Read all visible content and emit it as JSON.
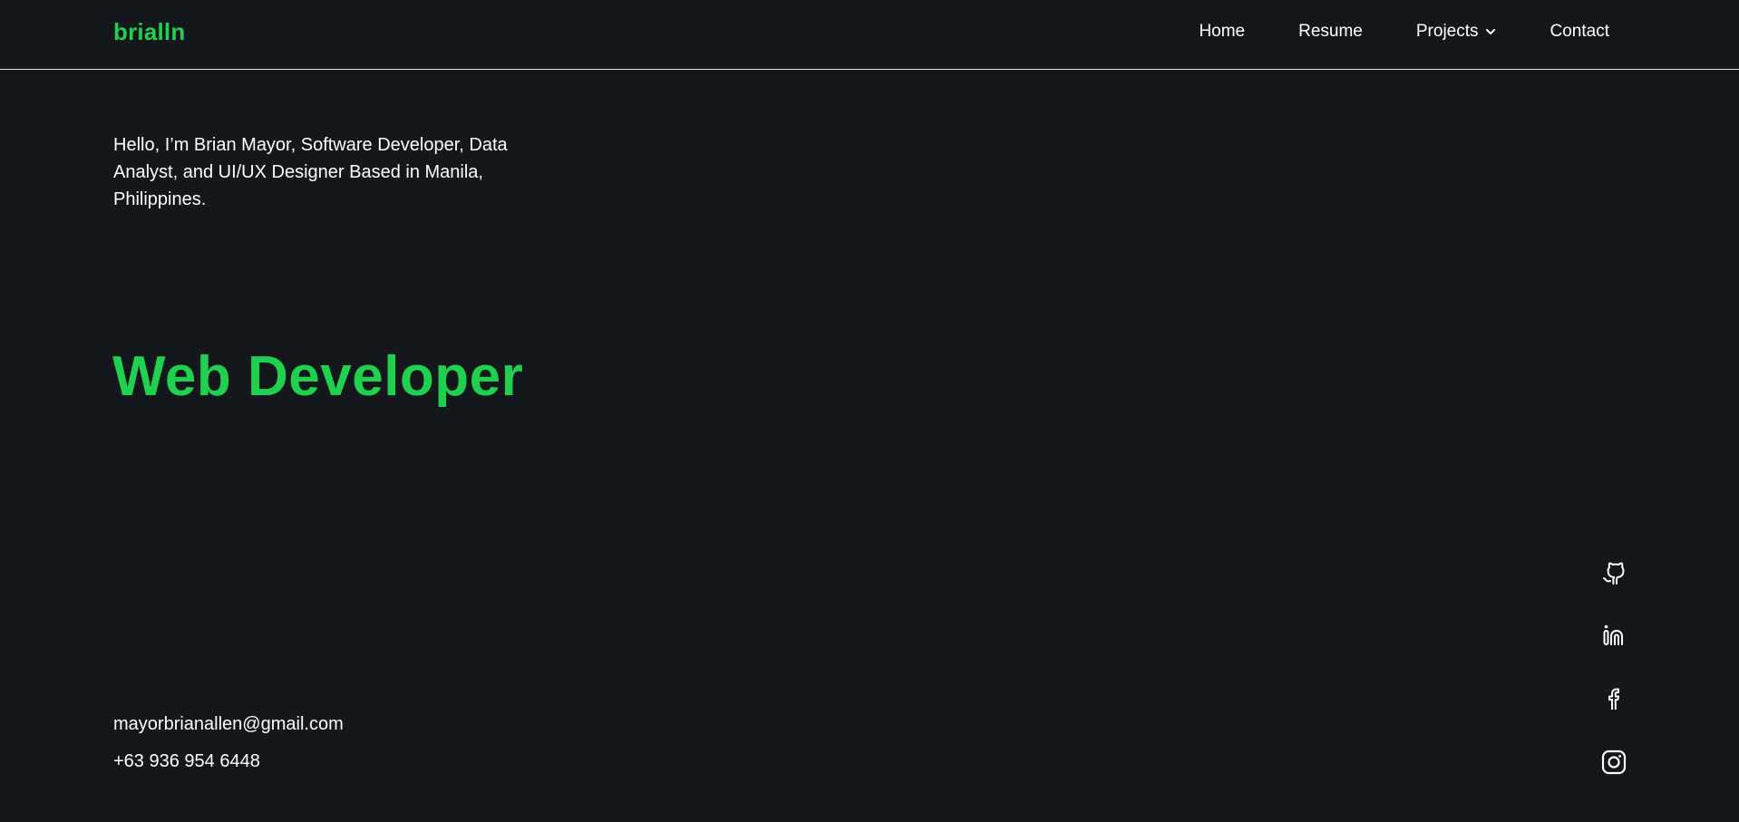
{
  "header": {
    "logo": "brialln",
    "nav": {
      "home": "Home",
      "resume": "Resume",
      "projects": "Projects",
      "contact": "Contact"
    }
  },
  "hero": {
    "intro": "Hello, I’m Brian Mayor, Software Developer, Data Analyst, and UI/UX Designer Based in Manila, Philippines.",
    "role": "Web Developer"
  },
  "contact": {
    "email": "mayorbrianallen@gmail.com",
    "phone": "+63 936 954 6448"
  },
  "social": {
    "icons": [
      "github-icon",
      "linkedin-icon",
      "facebook-icon",
      "instagram-icon"
    ]
  },
  "colors": {
    "background": "#14171c",
    "accent": "#1fd14f",
    "text": "#ffffff",
    "divider": "#e6e6e6"
  }
}
